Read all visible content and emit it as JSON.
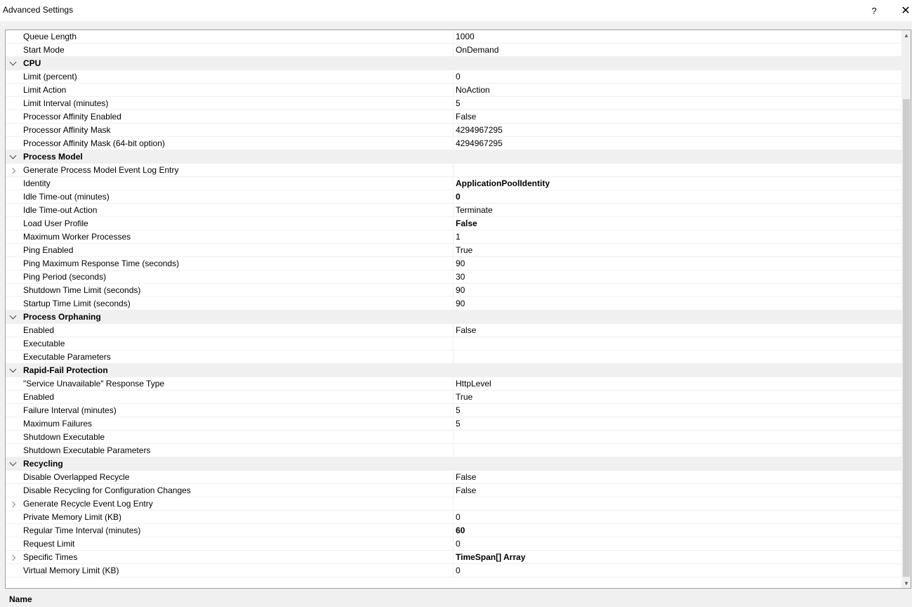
{
  "window": {
    "title": "Advanced Settings",
    "help_glyph": "?",
    "close_glyph": "✕"
  },
  "rows": [
    {
      "type": "prop",
      "name": "Queue Length",
      "value": "1000"
    },
    {
      "type": "prop",
      "name": "Start Mode",
      "value": "OnDemand"
    },
    {
      "type": "category",
      "name": "CPU"
    },
    {
      "type": "prop",
      "name": "Limit (percent)",
      "value": "0"
    },
    {
      "type": "prop",
      "name": "Limit Action",
      "value": "NoAction"
    },
    {
      "type": "prop",
      "name": "Limit Interval (minutes)",
      "value": "5"
    },
    {
      "type": "prop",
      "name": "Processor Affinity Enabled",
      "value": "False"
    },
    {
      "type": "prop",
      "name": "Processor Affinity Mask",
      "value": "4294967295"
    },
    {
      "type": "prop",
      "name": "Processor Affinity Mask (64-bit option)",
      "value": "4294967295"
    },
    {
      "type": "category",
      "name": "Process Model"
    },
    {
      "type": "prop",
      "name": "Generate Process Model Event Log Entry",
      "value": "",
      "expandable": true
    },
    {
      "type": "prop",
      "name": "Identity",
      "value": "ApplicationPoolIdentity",
      "bold": true
    },
    {
      "type": "prop",
      "name": "Idle Time-out (minutes)",
      "value": "0",
      "bold": true
    },
    {
      "type": "prop",
      "name": "Idle Time-out Action",
      "value": "Terminate"
    },
    {
      "type": "prop",
      "name": "Load User Profile",
      "value": "False",
      "bold": true
    },
    {
      "type": "prop",
      "name": "Maximum Worker Processes",
      "value": "1"
    },
    {
      "type": "prop",
      "name": "Ping Enabled",
      "value": "True"
    },
    {
      "type": "prop",
      "name": "Ping Maximum Response Time (seconds)",
      "value": "90"
    },
    {
      "type": "prop",
      "name": "Ping Period (seconds)",
      "value": "30"
    },
    {
      "type": "prop",
      "name": "Shutdown Time Limit (seconds)",
      "value": "90"
    },
    {
      "type": "prop",
      "name": "Startup Time Limit (seconds)",
      "value": "90"
    },
    {
      "type": "category",
      "name": "Process Orphaning"
    },
    {
      "type": "prop",
      "name": "Enabled",
      "value": "False"
    },
    {
      "type": "prop",
      "name": "Executable",
      "value": ""
    },
    {
      "type": "prop",
      "name": "Executable Parameters",
      "value": ""
    },
    {
      "type": "category",
      "name": "Rapid-Fail Protection"
    },
    {
      "type": "prop",
      "name": "\"Service Unavailable\" Response Type",
      "value": "HttpLevel"
    },
    {
      "type": "prop",
      "name": "Enabled",
      "value": "True"
    },
    {
      "type": "prop",
      "name": "Failure Interval (minutes)",
      "value": "5"
    },
    {
      "type": "prop",
      "name": "Maximum Failures",
      "value": "5"
    },
    {
      "type": "prop",
      "name": "Shutdown Executable",
      "value": ""
    },
    {
      "type": "prop",
      "name": "Shutdown Executable Parameters",
      "value": ""
    },
    {
      "type": "category",
      "name": "Recycling"
    },
    {
      "type": "prop",
      "name": "Disable Overlapped Recycle",
      "value": "False"
    },
    {
      "type": "prop",
      "name": "Disable Recycling for Configuration Changes",
      "value": "False"
    },
    {
      "type": "prop",
      "name": "Generate Recycle Event Log Entry",
      "value": "",
      "expandable": true
    },
    {
      "type": "prop",
      "name": "Private Memory Limit (KB)",
      "value": "0"
    },
    {
      "type": "prop",
      "name": "Regular Time Interval (minutes)",
      "value": "60",
      "bold": true
    },
    {
      "type": "prop",
      "name": "Request Limit",
      "value": "0"
    },
    {
      "type": "prop",
      "name": "Specific Times",
      "value": "TimeSpan[] Array",
      "bold": true,
      "expandable": true
    },
    {
      "type": "prop",
      "name": "Virtual Memory Limit (KB)",
      "value": "0"
    }
  ],
  "status": {
    "label": "Name"
  }
}
